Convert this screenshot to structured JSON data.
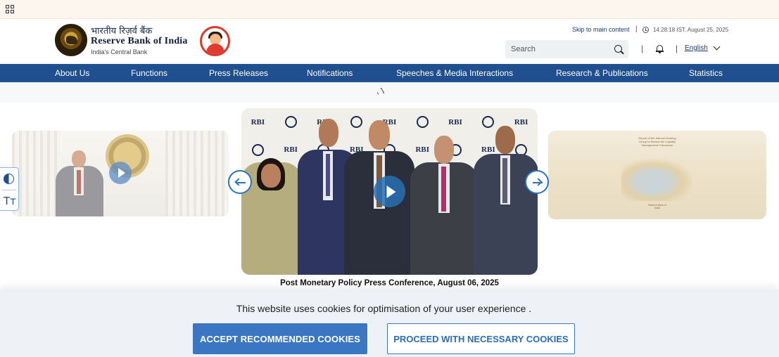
{
  "topbar": {
    "apps_icon": "grid-icon"
  },
  "header": {
    "title_hindi": "भारतीय रिज़र्व बैंक",
    "title_english": "Reserve Bank of India",
    "subtitle": "India's Central Bank",
    "emblem_icon": "rbi-emblem",
    "mascot_icon": "rbi-mascot",
    "skip_link": "Skip to main content",
    "datetime": "14:28:18 IST, August 25, 2025",
    "search_placeholder": "Search",
    "language": "English"
  },
  "nav": {
    "items": [
      {
        "label": "About Us"
      },
      {
        "label": "Functions"
      },
      {
        "label": "Press Releases"
      },
      {
        "label": "Notifications"
      },
      {
        "label": "Speeches & Media Interactions"
      },
      {
        "label": "Research & Publications"
      },
      {
        "label": "Statistics"
      }
    ]
  },
  "announcement": {
    "icon": "megaphone-icon"
  },
  "accessibility": {
    "contrast_icon": "contrast-icon",
    "text_size_label": "Tт"
  },
  "carousel": {
    "caption": "Post Monetary Policy Press Conference, August 06, 2025",
    "backdrop_text": "RBI",
    "right_slide_title": "Report of the Internal Working Group to Review the Liquidity Management Framework",
    "right_slide_footer": "Reserve Bank of India"
  },
  "cookie_banner": {
    "message": "This website uses cookies for optimisation of your user experience .",
    "accept_label": "ACCEPT RECOMMENDED COOKIES",
    "necessary_label": "PROCEED WITH NECESSARY COOKIES"
  },
  "colors": {
    "nav_bg": "#1f4f8f",
    "accent": "#3a76c2",
    "topbar_bg": "#fdf6ee"
  }
}
